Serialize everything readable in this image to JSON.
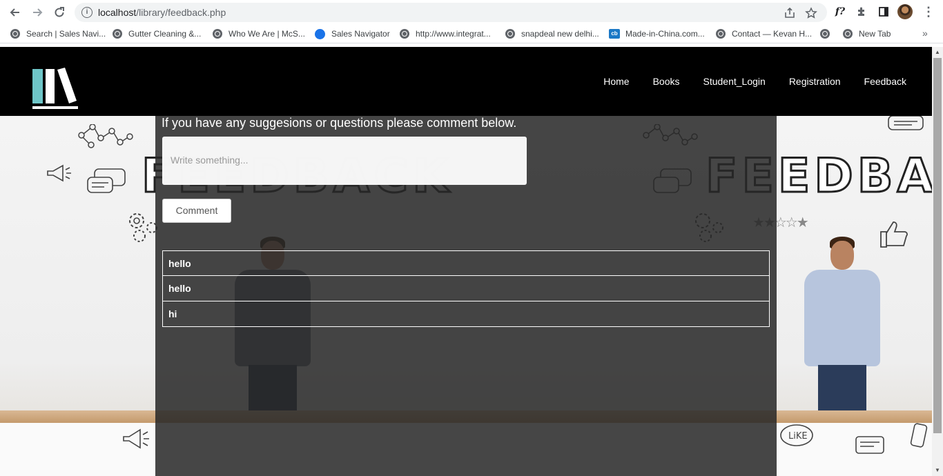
{
  "browser": {
    "url_host": "localhost",
    "url_path": "/library/feedback.php",
    "bookmarks": [
      "Search | Sales Navi...",
      "Gutter Cleaning &...",
      "Who We Are | McS...",
      "Sales Navigator",
      "http://www.integrat...",
      "snapdeal new delhi...",
      "Made-in-China.com...",
      "Contact — Kevan H...",
      "",
      "New Tab"
    ],
    "bookmark_icon_cb": "cb",
    "fx_icon": "f?",
    "more": "»"
  },
  "nav": {
    "items": [
      "Home",
      "Books",
      "Student_Login",
      "Registration",
      "Feedback"
    ]
  },
  "background": {
    "word": "FEEDBACK"
  },
  "form": {
    "prompt": "If you have any suggesions or questions please comment below.",
    "placeholder": "Write something...",
    "button": "Comment"
  },
  "comments": [
    "hello",
    "hello",
    "hi"
  ],
  "colors": {
    "navbar": "#000000",
    "logo_accent": "#6ec6c8",
    "overlay": "rgba(40,40,40,0.86)"
  }
}
